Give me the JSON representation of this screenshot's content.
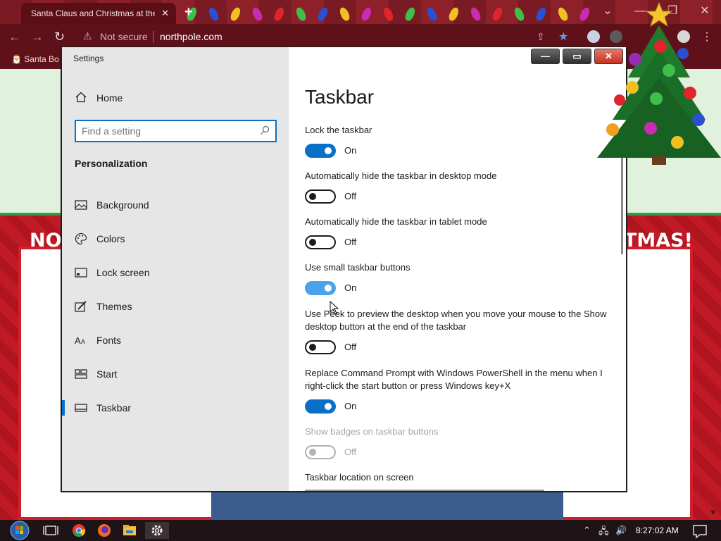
{
  "browser": {
    "tab_title": "Santa Claus and Christmas at the",
    "tab_close": "✕",
    "new_tab": "+",
    "security_label": "Not secure",
    "url": "northpole.com",
    "bookmark": "Santa Bo",
    "window_controls": [
      "⌄",
      "—",
      "❐",
      "✕"
    ]
  },
  "page": {
    "banner_left": "NO",
    "banner_right": "TMAS!"
  },
  "settings": {
    "window_title": "Settings",
    "home_label": "Home",
    "search_placeholder": "Find a setting",
    "section_title": "Personalization",
    "nav_items": [
      {
        "label": "Background",
        "icon": "picture-icon"
      },
      {
        "label": "Colors",
        "icon": "palette-icon"
      },
      {
        "label": "Lock screen",
        "icon": "lock-screen-icon"
      },
      {
        "label": "Themes",
        "icon": "brush-icon"
      },
      {
        "label": "Fonts",
        "icon": "font-icon"
      },
      {
        "label": "Start",
        "icon": "start-icon"
      },
      {
        "label": "Taskbar",
        "icon": "taskbar-icon",
        "active": true
      }
    ],
    "page_title": "Taskbar",
    "options": [
      {
        "label": "Lock the taskbar",
        "state": "On"
      },
      {
        "label": "Automatically hide the taskbar in desktop mode",
        "state": "Off"
      },
      {
        "label": "Automatically hide the taskbar in tablet mode",
        "state": "Off"
      },
      {
        "label": "Use small taskbar buttons",
        "state": "On"
      },
      {
        "label": "Use Peek to preview the desktop when you move your mouse to the Show desktop button at the end of the taskbar",
        "state": "Off"
      },
      {
        "label": "Replace Command Prompt with Windows PowerShell in the menu when I right-click the start button or press Windows key+X",
        "state": "On"
      },
      {
        "label": "Show badges on taskbar buttons",
        "state": "Off",
        "disabled": true
      }
    ],
    "location_label": "Taskbar location on screen"
  },
  "window_buttons": {
    "minimize": "—",
    "maximize": "▭",
    "close": "✕"
  },
  "taskbar": {
    "clock": "8:27:02 AM",
    "apps": [
      "start-orb-icon",
      "task-view-icon",
      "chrome-icon",
      "firefox-icon",
      "file-explorer-icon",
      "settings-gear-icon"
    ]
  },
  "colors": {
    "accent": "#0a6fc7",
    "browser_frame": "#5e1118",
    "page_red": "#c01a26"
  }
}
